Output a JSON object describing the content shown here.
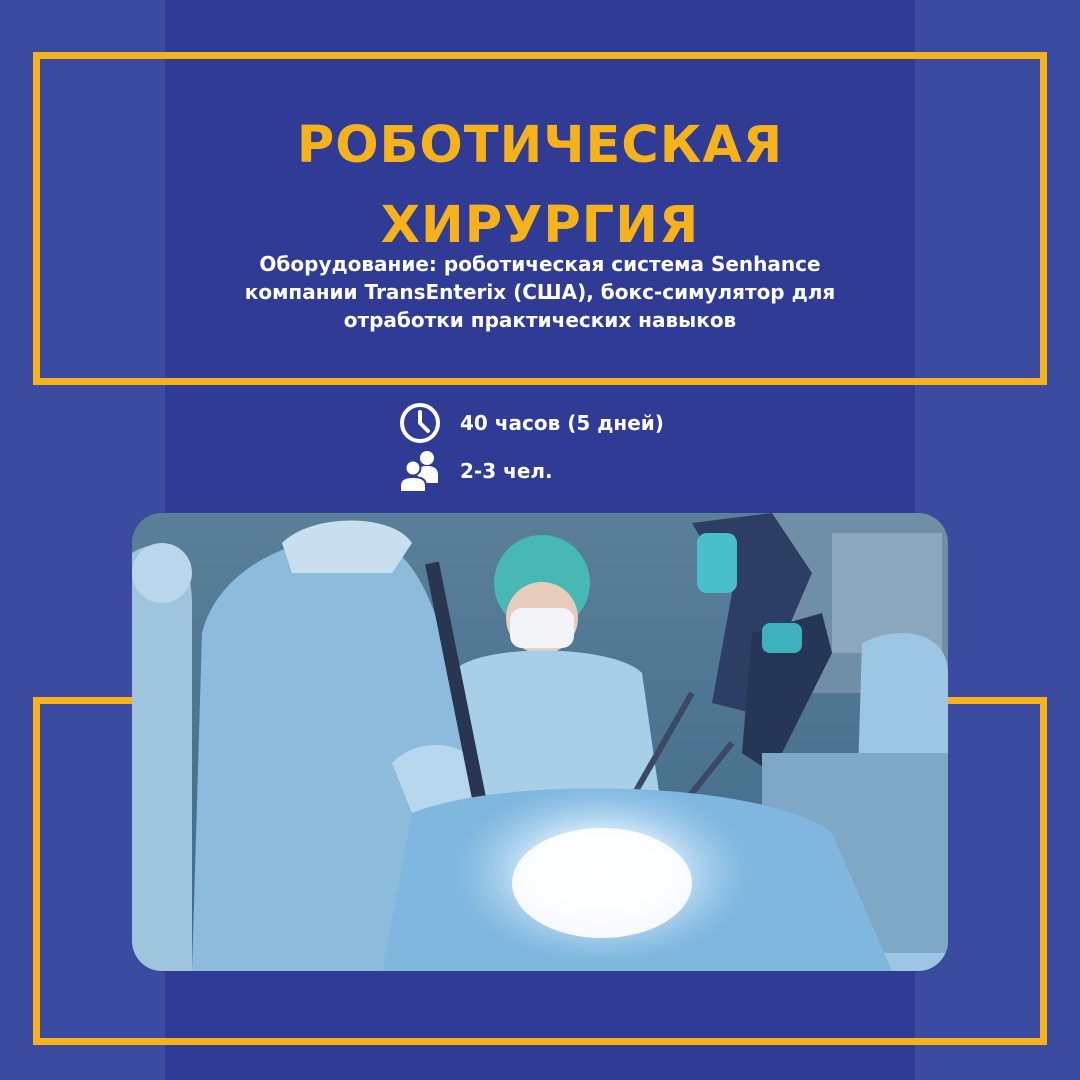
{
  "title": "РОБОТИЧЕСКАЯ\nХИРУРГИЯ",
  "subtitle": "Оборудование: роботическая система Senhance\nкомпании TransEnterix (США), бокс-симулятор для\nотработки практических навыков",
  "info": {
    "duration": {
      "icon": "clock-icon",
      "text": "40 часов (5 дней)"
    },
    "group": {
      "icon": "people-icon",
      "text": "2-3 чел."
    }
  },
  "colors": {
    "background": "#3a4ba0",
    "center_strip": "#2f3b94",
    "accent": "#f6b21a",
    "text": "#ffffff"
  }
}
